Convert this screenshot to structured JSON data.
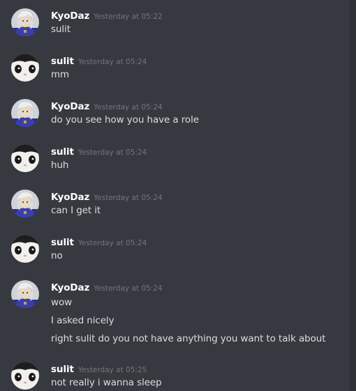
{
  "colors": {
    "background": "#36393f",
    "username": "#ffffff",
    "message_text": "#dcddde",
    "timestamp": "#72767d"
  },
  "messages": [
    {
      "author": "KyoDaz",
      "avatar": "kyodaz-avatar",
      "timestamp": "Yesterday at 05:22",
      "lines": [
        "sulit"
      ]
    },
    {
      "author": "sulit",
      "avatar": "sulit-avatar",
      "timestamp": "Yesterday at 05:24",
      "lines": [
        "mm"
      ]
    },
    {
      "author": "KyoDaz",
      "avatar": "kyodaz-avatar",
      "timestamp": "Yesterday at 05:24",
      "lines": [
        "do you see how you have a role"
      ]
    },
    {
      "author": "sulit",
      "avatar": "sulit-avatar",
      "timestamp": "Yesterday at 05:24",
      "lines": [
        "huh"
      ]
    },
    {
      "author": "KyoDaz",
      "avatar": "kyodaz-avatar",
      "timestamp": "Yesterday at 05:24",
      "lines": [
        "can I get it"
      ]
    },
    {
      "author": "sulit",
      "avatar": "sulit-avatar",
      "timestamp": "Yesterday at 05:24",
      "lines": [
        "no"
      ]
    },
    {
      "author": "KyoDaz",
      "avatar": "kyodaz-avatar",
      "timestamp": "Yesterday at 05:24",
      "lines": [
        "wow",
        "I asked nicely",
        "right sulit do you not have anything you want to talk about"
      ]
    },
    {
      "author": "sulit",
      "avatar": "sulit-avatar",
      "timestamp": "Yesterday at 05:25",
      "lines": [
        "not really i wanna sleep"
      ]
    }
  ]
}
